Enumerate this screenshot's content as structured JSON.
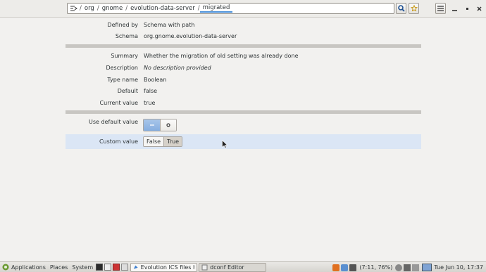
{
  "header": {
    "breadcrumbs": [
      "org",
      "gnome",
      "evolution-data-server",
      "migrated"
    ],
    "separator": "/"
  },
  "details": {
    "defined_by_label": "Defined by",
    "defined_by_value": "Schema with path",
    "schema_label": "Schema",
    "schema_value": "org.gnome.evolution-data-server",
    "summary_label": "Summary",
    "summary_value": "Whether the migration of old setting was already done",
    "description_label": "Description",
    "description_value": "No description provided",
    "type_label": "Type name",
    "type_value": "Boolean",
    "default_label": "Default",
    "default_value": "false",
    "current_label": "Current value",
    "current_value": "true"
  },
  "controls": {
    "use_default_label": "Use default value",
    "use_default_state": "on",
    "custom_label": "Custom value",
    "custom_options": [
      "False",
      "True"
    ],
    "custom_selected": "True"
  },
  "taskbar": {
    "applications": "Applications",
    "places": "Places",
    "system": "System",
    "tasks": [
      "Evolution ICS files Ke...",
      "dconf Editor"
    ],
    "battery": "(7:11, 76%)",
    "clock": "Tue Jun 10, 17:37"
  },
  "colors": {
    "accent": "#4a90d9",
    "selected_row": "#dbe6f5",
    "separator": "#c8c6c2"
  }
}
